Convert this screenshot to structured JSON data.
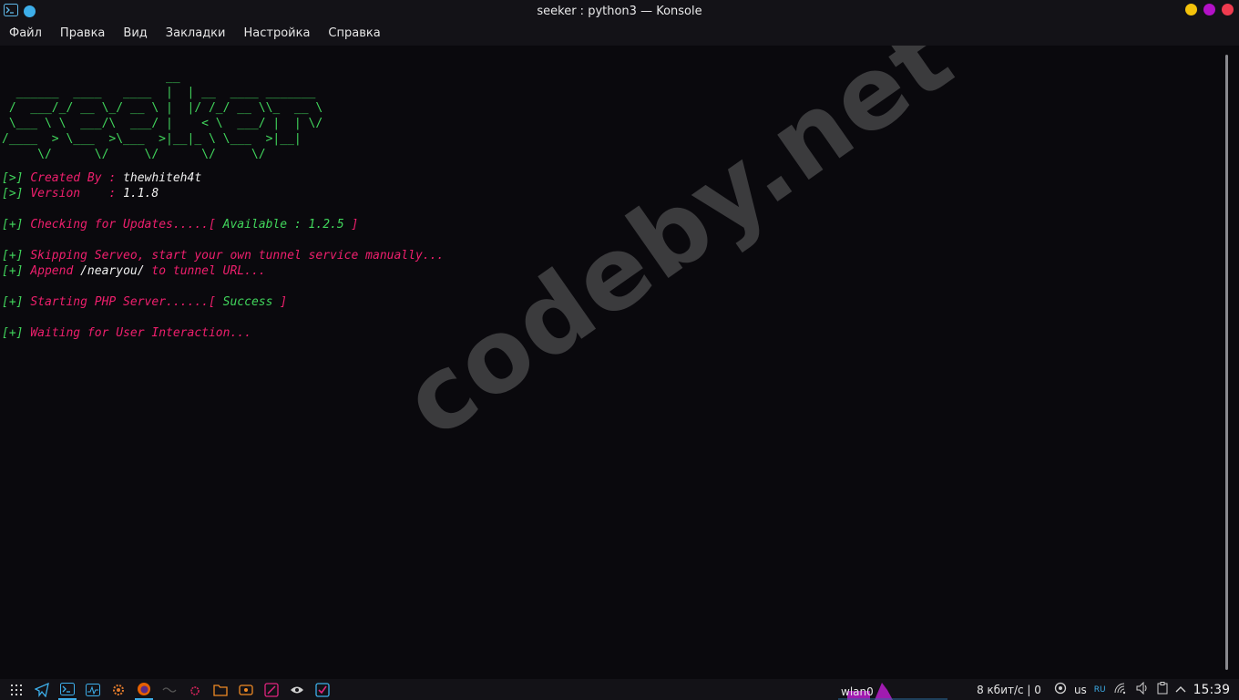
{
  "window": {
    "title": "seeker : python3 — Konsole",
    "controls": [
      "minimize-button",
      "maximize-button",
      "close-button"
    ],
    "control_colors": [
      "#f3c20b",
      "#b311c7",
      "#ef3b4f"
    ]
  },
  "menu": {
    "items": [
      "Файл",
      "Правка",
      "Вид",
      "Закладки",
      "Настройка",
      "Справка"
    ]
  },
  "terminal": {
    "ascii_art": "                       __\n  ______  ____   ____  |  | __  ____ _______\n /  ___/_/ __ \\_/ __ \\ |  |/ /_/ __ \\\\_  __ \\\n \\___ \\ \\  ___/\\  ___/ |    < \\  ___/ |  | \\/\n/____  > \\___  >\\___  >|__|_ \\ \\___  >|__|\n     \\/      \\/     \\/      \\/     \\/",
    "created_prefix": "[>]",
    "created_label": "Created By :",
    "created_value": "thewhiteh4t",
    "version_prefix": "[>]",
    "version_label": "Version    :",
    "version_value": "1.1.8",
    "updates_prefix": "[+]",
    "updates_label": "Checking for Updates.....",
    "updates_open": "[",
    "updates_status": "Available : 1.2.5",
    "updates_close": "]",
    "serveo_prefix": "[+]",
    "serveo_text": "Skipping Serveo, start your own tunnel service manually...",
    "append_prefix": "[+]",
    "append_label": "Append",
    "append_path": "/nearyou/",
    "append_suffix": "to tunnel URL...",
    "php_prefix": "[+]",
    "php_label": "Starting PHP Server......",
    "php_open": "[",
    "php_status": "Success",
    "php_close": "]",
    "wait_prefix": "[+]",
    "wait_text": "Waiting for User Interaction..."
  },
  "watermark": "codeby.net",
  "taskbar": {
    "network_label": "wlan0",
    "network_speed": "8 кбит/с | 0",
    "keyboard_layout": "us",
    "locale_badge": "RU",
    "clock": "15:39"
  },
  "colors": {
    "green": "#41d65c",
    "pink": "#ef1f6d",
    "background": "#0a090d"
  }
}
